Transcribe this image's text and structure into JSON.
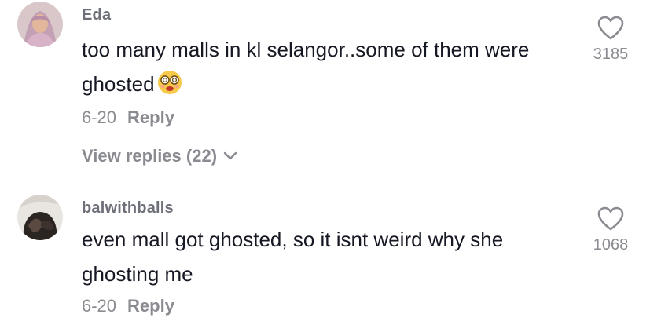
{
  "comments": [
    {
      "username": "Eda",
      "text": "too many malls in kl selangor..some of them were ghosted",
      "emoji": "dizzy-face-emoji",
      "date": "6-20",
      "reply_label": "Reply",
      "likes": "3185",
      "view_replies": "View replies (22)"
    },
    {
      "username": "balwithballs",
      "text": "even mall got ghosted, so it isnt weird why she ghosting me",
      "date": "6-20",
      "reply_label": "Reply",
      "likes": "1068"
    }
  ]
}
